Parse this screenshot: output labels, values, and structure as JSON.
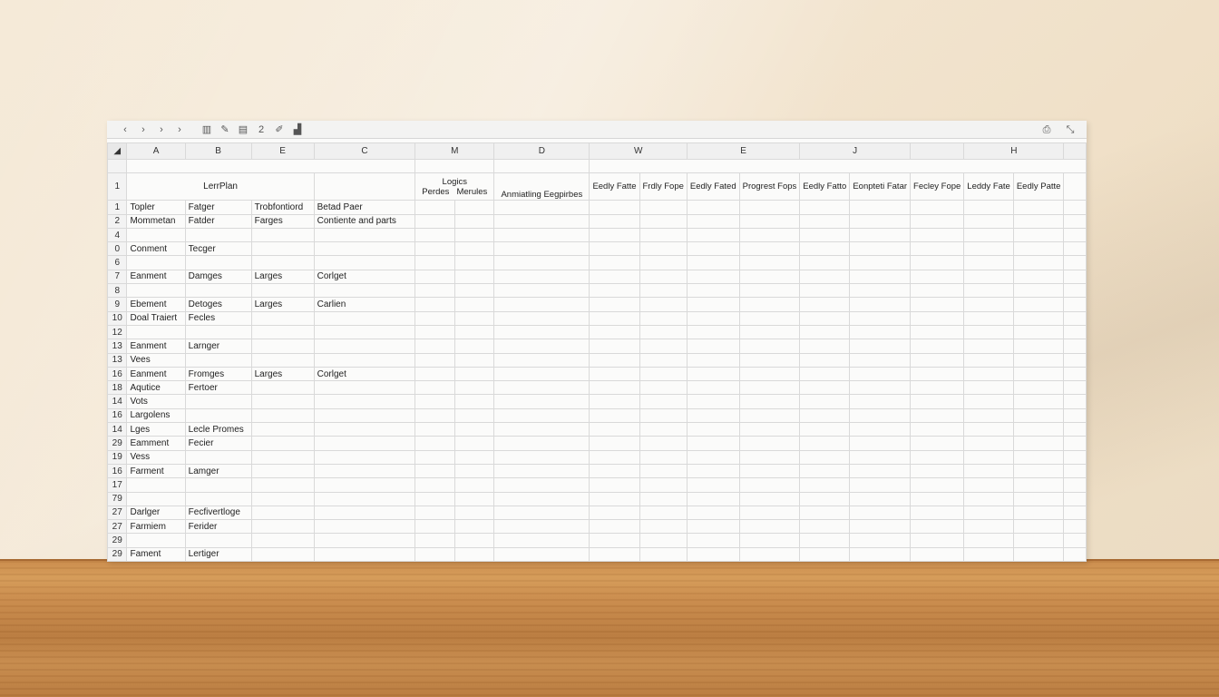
{
  "toolbar": {
    "buttons": [
      "back-arrow",
      "forward-arrow",
      "next-arrow",
      "next-arrow-2",
      "columns-icon",
      "pen-icon",
      "frame-icon",
      "sum-icon",
      "edit-icon",
      "chart-icon"
    ],
    "back": "‹",
    "fwd1": "›",
    "fwd2": "›",
    "fwd3": "›",
    "g1": "▥",
    "g2": "✎",
    "g3": "▤",
    "g4": "2",
    "g5": "✐",
    "g6": "▟",
    "share": "⎙",
    "close": "⤡"
  },
  "columns": [
    "A",
    "B",
    "E",
    "C",
    "M",
    "",
    "D",
    "W",
    "",
    "E",
    "",
    "J",
    "",
    "H",
    "",
    ""
  ],
  "header": {
    "row_num": "1",
    "title": "LerrPlan",
    "group_label": "Logics",
    "sub": [
      "Perdes",
      "Merules",
      "Anmiatling Eegpirbes",
      "Eedly Fatte",
      "Frdly Fope",
      "Eedly Fated",
      "Progrest Fops",
      "Eedly Fatto",
      "Eonpteti Fatar",
      "Fecley Fope",
      "Leddy Fate",
      "Eedly Patte"
    ]
  },
  "rows": [
    {
      "n": "1",
      "a": "Topler",
      "b": "Fatger",
      "e": "Trobfontiord",
      "c": "Betad Paer"
    },
    {
      "n": "2",
      "a": "Mommetan",
      "b": "Fatder",
      "e": "Farges",
      "c": "Contiente and parts"
    },
    {
      "n": "4",
      "a": "",
      "b": "",
      "e": "",
      "c": ""
    },
    {
      "n": "0",
      "a": "Conment",
      "b": "Tecger",
      "e": "",
      "c": ""
    },
    {
      "n": "6",
      "a": "",
      "b": "",
      "e": "",
      "c": ""
    },
    {
      "n": "7",
      "a": "Eanment",
      "b": "Damges",
      "e": "Larges",
      "c": "Corlget"
    },
    {
      "n": "8",
      "a": "",
      "b": "",
      "e": "",
      "c": ""
    },
    {
      "n": "9",
      "a": "Ebement",
      "b": "Detoges",
      "e": "Larges",
      "c": "Carlien"
    },
    {
      "n": "10",
      "a": "Doal Traiert",
      "b": "Fecles",
      "e": "",
      "c": ""
    },
    {
      "n": "12",
      "a": "",
      "b": "",
      "e": "",
      "c": ""
    },
    {
      "n": "13",
      "a": "Eanment",
      "b": "Larnger",
      "e": "",
      "c": ""
    },
    {
      "n": "13",
      "a": "Vees",
      "b": "",
      "e": "",
      "c": ""
    },
    {
      "n": "16",
      "a": "Eanment",
      "b": "Fromges",
      "e": "Larges",
      "c": "Corlget"
    },
    {
      "n": "18",
      "a": "Aqutice",
      "b": "Fertoer",
      "e": "",
      "c": ""
    },
    {
      "n": "14",
      "a": "Vots",
      "b": "",
      "e": "",
      "c": ""
    },
    {
      "n": "16",
      "a": "Largolens",
      "b": "",
      "e": "",
      "c": ""
    },
    {
      "n": "14",
      "a": "Lges",
      "b": "Lecle Promes",
      "e": "",
      "c": ""
    },
    {
      "n": "29",
      "a": "Eamment",
      "b": "Fecier",
      "e": "",
      "c": ""
    },
    {
      "n": "19",
      "a": "Vess",
      "b": "",
      "e": "",
      "c": ""
    },
    {
      "n": "16",
      "a": "Farment",
      "b": "Lamger",
      "e": "",
      "c": ""
    },
    {
      "n": "17",
      "a": "",
      "b": "",
      "e": "",
      "c": ""
    },
    {
      "n": "79",
      "a": "",
      "b": "",
      "e": "",
      "c": ""
    },
    {
      "n": "27",
      "a": "Darlger",
      "b": "Fecfivertloge",
      "e": "",
      "c": ""
    },
    {
      "n": "27",
      "a": "Farmiem",
      "b": "Ferider",
      "e": "",
      "c": ""
    },
    {
      "n": "29",
      "a": "",
      "b": "",
      "e": "",
      "c": ""
    },
    {
      "n": "29",
      "a": "Fament",
      "b": "Lertiger",
      "e": "",
      "c": ""
    }
  ]
}
